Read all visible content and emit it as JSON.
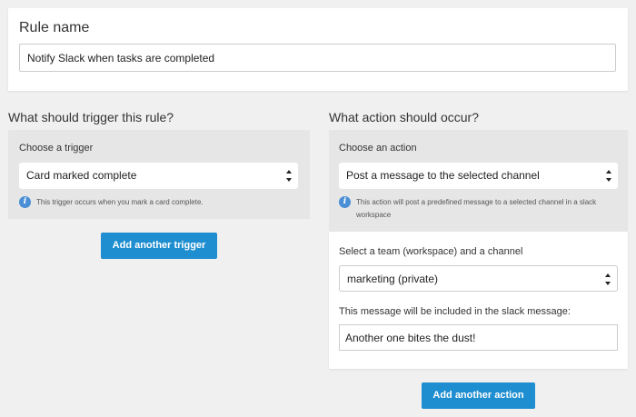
{
  "rule": {
    "title": "Rule name",
    "name_value": "Notify Slack when tasks are completed"
  },
  "trigger": {
    "heading": "What should trigger this rule?",
    "choose_label": "Choose a trigger",
    "selected": "Card marked complete",
    "info": "This trigger occurs when you mark a card complete.",
    "add_button": "Add another trigger"
  },
  "action": {
    "heading": "What action should occur?",
    "choose_label": "Choose an action",
    "selected": "Post a message to the selected channel",
    "info_line1": "This action will post a predefined message to a selected channel in a slack",
    "info_line2": "workspace",
    "team_label": "Select a team (workspace) and a channel",
    "team_selected": "marketing (private)",
    "message_label": "This message will be included in the slack message:",
    "message_value": "Another one bites the dust!",
    "add_button": "Add another action"
  },
  "icons": {
    "info": "info-icon",
    "select_arrows": "select-arrows-icon"
  },
  "colors": {
    "accent": "#1f8ed0",
    "info_icon": "#4a8fd6"
  }
}
